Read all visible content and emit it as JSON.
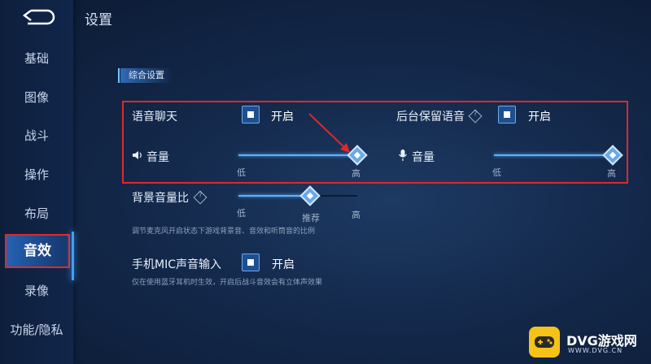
{
  "header": {
    "title": "设置"
  },
  "sidebar": {
    "items": [
      {
        "label": "基础"
      },
      {
        "label": "图像"
      },
      {
        "label": "战斗"
      },
      {
        "label": "操作"
      },
      {
        "label": "布局"
      },
      {
        "label": "音效",
        "active": true
      },
      {
        "label": "录像"
      },
      {
        "label": "功能/隐私"
      }
    ]
  },
  "section": {
    "title": "综合设置"
  },
  "voice_chat": {
    "label": "语音聊天",
    "toggle_label": "开启",
    "checked": true
  },
  "bg_voice": {
    "label": "后台保留语音",
    "toggle_label": "开启",
    "checked": true,
    "help": "?"
  },
  "volume_left": {
    "label": "音量",
    "min_label": "低",
    "max_label": "高",
    "value": 1.0,
    "icon": "speaker-icon"
  },
  "volume_right": {
    "label": "音量",
    "min_label": "低",
    "max_label": "高",
    "value": 1.0,
    "icon": "microphone-icon"
  },
  "bg_ratio": {
    "label": "背景音量比",
    "help": "?",
    "min_label": "低",
    "mid_label": "推荐",
    "max_label": "高",
    "value": 0.6,
    "hint": "调节麦克风开启状态下游戏背景音、音效和听筒音的比例"
  },
  "mic_input": {
    "label": "手机MIC声音输入",
    "toggle_label": "开启",
    "checked": true,
    "hint": "仅在使用蓝牙耳机时生效，开启后战斗音效会有立体声效果"
  },
  "watermark": {
    "brand": "DVG游戏网",
    "url": "WWW.DVG.CN"
  },
  "colors": {
    "accent": "#5fb2ff",
    "highlight": "#e0282a",
    "bg": "#13284a",
    "logo": "#f5c218"
  }
}
